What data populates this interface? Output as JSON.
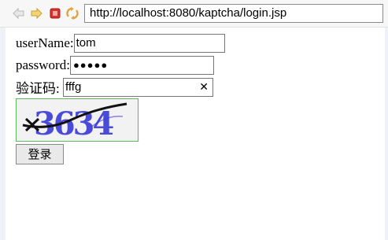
{
  "browser": {
    "url": "http://localhost:8080/kaptcha/login.jsp",
    "icons": [
      "back-arrow-icon",
      "forward-arrow-icon",
      "stop-icon",
      "refresh-icon"
    ]
  },
  "form": {
    "username_label": "userName:",
    "username_value": "tom",
    "password_label": "password:",
    "password_value": "●●●●●",
    "captcha_label": "验证码:",
    "captcha_value": "fffg",
    "captcha_image_text": "3634",
    "submit_label": "登录"
  },
  "colors": {
    "captcha_text": "#2c2cff",
    "captcha_border": "#5cb85c"
  }
}
